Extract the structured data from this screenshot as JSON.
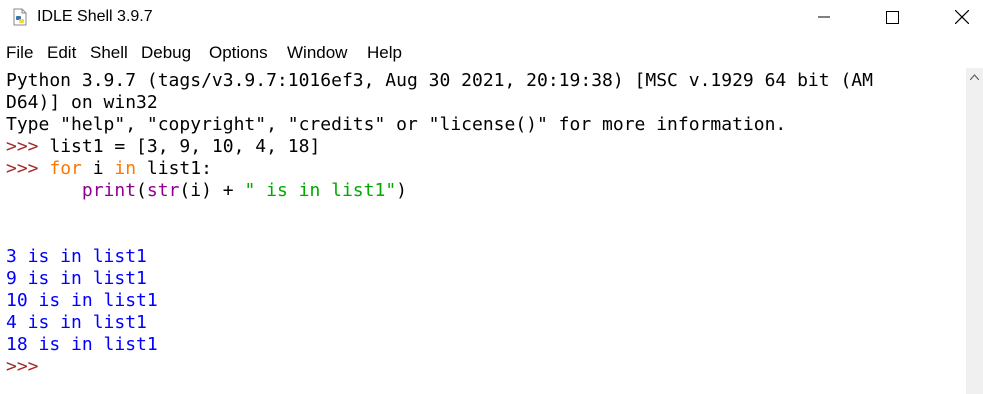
{
  "window": {
    "title": "IDLE Shell 3.9.7"
  },
  "menu": [
    "File",
    "Edit",
    "Shell",
    "Debug",
    "Options",
    "Window",
    "Help"
  ],
  "shell": {
    "banner1": "Python 3.9.7 (tags/v3.9.7:1016ef3, Aug 30 2021, 20:19:38) [MSC v.1929 64 bit (AM",
    "banner2": "D64)] on win32",
    "banner3": "Type \"help\", \"copyright\", \"credits\" or \"license()\" for more information.",
    "prompt": ">>>",
    "input1": " list1 = [3, 9, 10, 4, 18]",
    "input2_kw_for": "for",
    "input2_mid": " i ",
    "input2_kw_in": "in",
    "input2_end": " list1:",
    "input3_indent": "       ",
    "input3_print": "print",
    "input3_open": "(",
    "input3_str": "str",
    "input3_arg": "(i) + ",
    "input3_literal": "\" is in list1\"",
    "input3_close": ")",
    "outputs": [
      "3 is in list1",
      "9 is in list1",
      "10 is in list1",
      "4 is in list1",
      "18 is in list1"
    ],
    "final_prompt": ">>>"
  }
}
